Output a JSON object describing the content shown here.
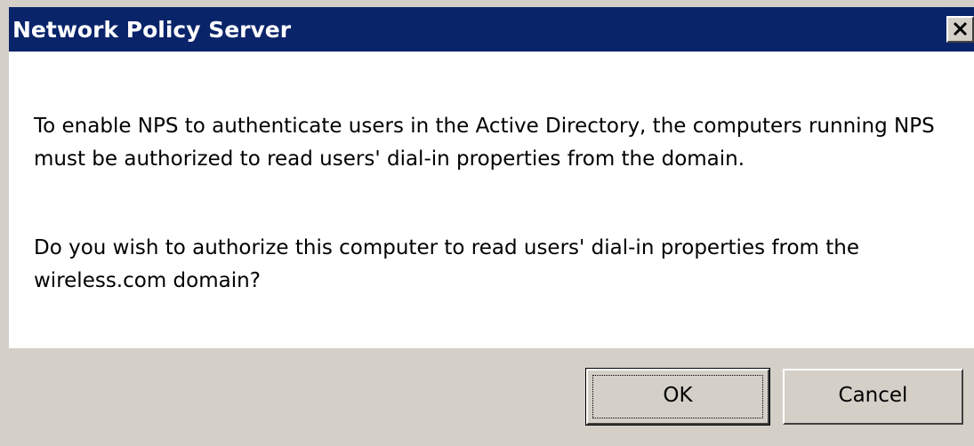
{
  "window": {
    "title": "Network Policy Server"
  },
  "message": {
    "paragraph_1": "To enable NPS to authenticate users in the Active Directory, the computers running NPS must be authorized to read users' dial-in properties from the domain.",
    "paragraph_2": "Do you wish to authorize this computer to read users' dial-in  properties from the wireless.com domain?"
  },
  "buttons": {
    "ok_label": "OK",
    "cancel_label": "Cancel"
  },
  "icons": {
    "close": "close-icon"
  },
  "colors": {
    "title_bar": "#0a246a",
    "title_text": "#ffffff",
    "dialog_background": "#ffffff",
    "button_face": "#d4d0c8"
  }
}
